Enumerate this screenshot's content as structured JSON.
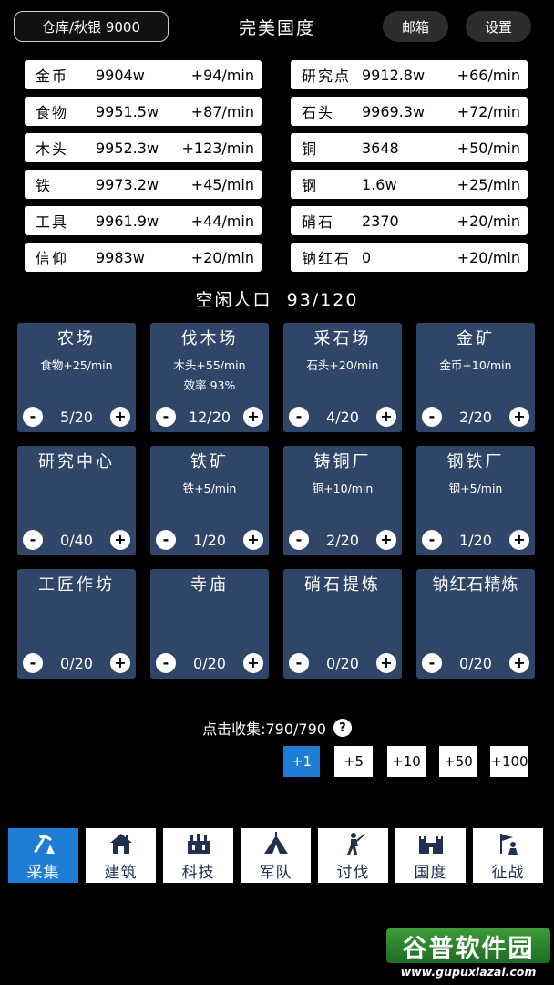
{
  "header": {
    "warehouse_label": "仓库/秋银 9000",
    "title": "完美国度",
    "mail_label": "邮箱",
    "settings_label": "设置"
  },
  "resources_left": [
    {
      "name": "金币",
      "amount": "9904w",
      "rate": "+94/min"
    },
    {
      "name": "食物",
      "amount": "9951.5w",
      "rate": "+87/min"
    },
    {
      "name": "木头",
      "amount": "9952.3w",
      "rate": "+123/min"
    },
    {
      "name": "铁",
      "amount": "9973.2w",
      "rate": "+45/min"
    },
    {
      "name": "工具",
      "amount": "9961.9w",
      "rate": "+44/min"
    },
    {
      "name": "信仰",
      "amount": "9983w",
      "rate": "+20/min"
    }
  ],
  "resources_right": [
    {
      "name": "研究点",
      "amount": "9912.8w",
      "rate": "+66/min"
    },
    {
      "name": "石头",
      "amount": "9969.3w",
      "rate": "+72/min"
    },
    {
      "name": "铜",
      "amount": "3648",
      "rate": "+50/min"
    },
    {
      "name": "钢",
      "amount": "1.6w",
      "rate": "+25/min"
    },
    {
      "name": "硝石",
      "amount": "2370",
      "rate": "+20/min"
    },
    {
      "name": "钠红石",
      "amount": "0",
      "rate": "+20/min"
    }
  ],
  "idle_population": "空闲人口  93/120",
  "buildings": [
    {
      "name": "农场",
      "production": "食物+25/min",
      "efficiency": "",
      "count": "5/20"
    },
    {
      "name": "伐木场",
      "production": "木头+55/min",
      "efficiency": "效率 93%",
      "count": "12/20"
    },
    {
      "name": "采石场",
      "production": "石头+20/min",
      "efficiency": "",
      "count": "4/20"
    },
    {
      "name": "金矿",
      "production": "金币+10/min",
      "efficiency": "",
      "count": "2/20"
    },
    {
      "name": "研究中心",
      "production": "",
      "efficiency": "",
      "count": "0/40"
    },
    {
      "name": "铁矿",
      "production": "铁+5/min",
      "efficiency": "",
      "count": "1/20"
    },
    {
      "name": "铸铜厂",
      "production": "铜+10/min",
      "efficiency": "",
      "count": "2/20"
    },
    {
      "name": "钢铁厂",
      "production": "钢+5/min",
      "efficiency": "",
      "count": "1/20"
    },
    {
      "name": "工匠作坊",
      "production": "",
      "efficiency": "",
      "count": "0/20"
    },
    {
      "name": "寺庙",
      "production": "",
      "efficiency": "",
      "count": "0/20"
    },
    {
      "name": "硝石提炼",
      "production": "",
      "efficiency": "",
      "count": "0/20"
    },
    {
      "name": "钠红石精炼",
      "production": "",
      "efficiency": "",
      "count": "0/20"
    }
  ],
  "controls": {
    "minus": "-",
    "plus": "+"
  },
  "collect": {
    "label": "点击收集:790/790",
    "help": "?"
  },
  "multipliers": [
    {
      "label": "+1",
      "active": true
    },
    {
      "label": "+5",
      "active": false
    },
    {
      "label": "+10",
      "active": false
    },
    {
      "label": "+50",
      "active": false
    },
    {
      "label": "+100",
      "active": false
    }
  ],
  "nav": [
    {
      "label": "采集",
      "icon": "mining-icon",
      "active": true
    },
    {
      "label": "建筑",
      "icon": "house-icon",
      "active": false
    },
    {
      "label": "科技",
      "icon": "lab-icon",
      "active": false
    },
    {
      "label": "军队",
      "icon": "tent-icon",
      "active": false
    },
    {
      "label": "讨伐",
      "icon": "warrior-icon",
      "active": false
    },
    {
      "label": "国度",
      "icon": "castle-icon",
      "active": false
    },
    {
      "label": "征战",
      "icon": "flag-icon",
      "active": false
    }
  ],
  "watermark": {
    "cn": "谷普软件园",
    "url": "www.gupuxiazai.com"
  },
  "colors": {
    "card_bg": "#2f4668",
    "accent": "#1e7ed6",
    "background": "#000000"
  }
}
